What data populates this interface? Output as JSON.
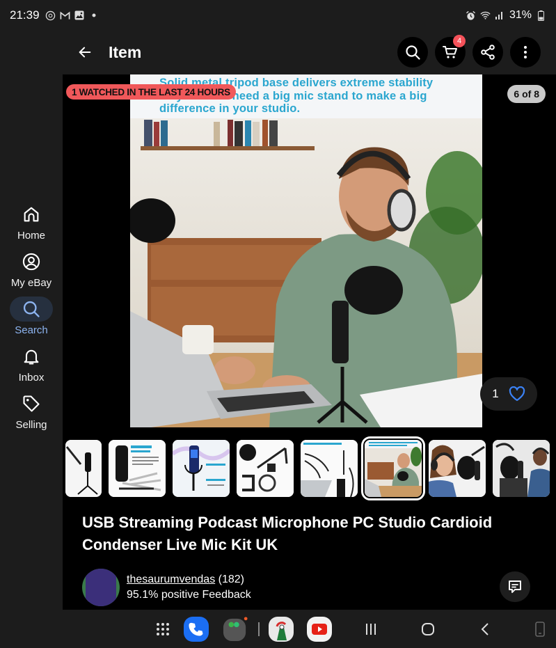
{
  "status_bar": {
    "time": "21:39",
    "notification_icons": [
      "badge-icon",
      "gmail-icon",
      "gallery-icon",
      "dot-icon"
    ],
    "system_icons": [
      "alarm-icon",
      "wifi-icon",
      "signal-icon",
      "battery-icon"
    ],
    "battery": "31%"
  },
  "header": {
    "title": "Item",
    "cart_count": "4",
    "actions": [
      "search",
      "cart",
      "share",
      "more"
    ]
  },
  "nav_rail": {
    "items": [
      {
        "label": "Home",
        "icon": "home-icon",
        "active": false
      },
      {
        "label": "My eBay",
        "icon": "profile-icon",
        "active": false
      },
      {
        "label": "Search",
        "icon": "search-icon",
        "active": true
      },
      {
        "label": "Inbox",
        "icon": "bell-icon",
        "active": false
      },
      {
        "label": "Selling",
        "icon": "tag-icon",
        "active": false
      }
    ]
  },
  "gallery": {
    "watch_badge": "1 WATCHED IN THE LAST 24 HOURS",
    "counter": "6 of 8",
    "current_index": 6,
    "total": 8,
    "banner_text": "Solid metal tripod base delivers extreme stability so you don't need a big mic stand to make a big difference in your studio.",
    "banner_lines": [
      "Solid metal tripod base delivers extreme stability",
      "so you don't need a big mic stand to make a big",
      "difference in your studio."
    ],
    "watchers": "1",
    "thumbnails": [
      "mic-on-tripod",
      "product-specifications",
      "mic-blue-light",
      "pop-filter-and-arm",
      "usb-plug-and-play",
      "man-podcasting",
      "woman-with-headphones",
      "man-singing"
    ]
  },
  "listing": {
    "title": "USB Streaming Podcast Microphone PC Studio Cardioid Condenser Live Mic Kit UK",
    "seller_name": "thesaurumvendas",
    "seller_score": "(182)",
    "feedback": "95.1% positive Feedback"
  },
  "colors": {
    "accent_blue": "#3b82f6",
    "badge_red": "#f0585a",
    "active_nav": "#8db4f0",
    "banner_text": "#2aa6cf"
  }
}
